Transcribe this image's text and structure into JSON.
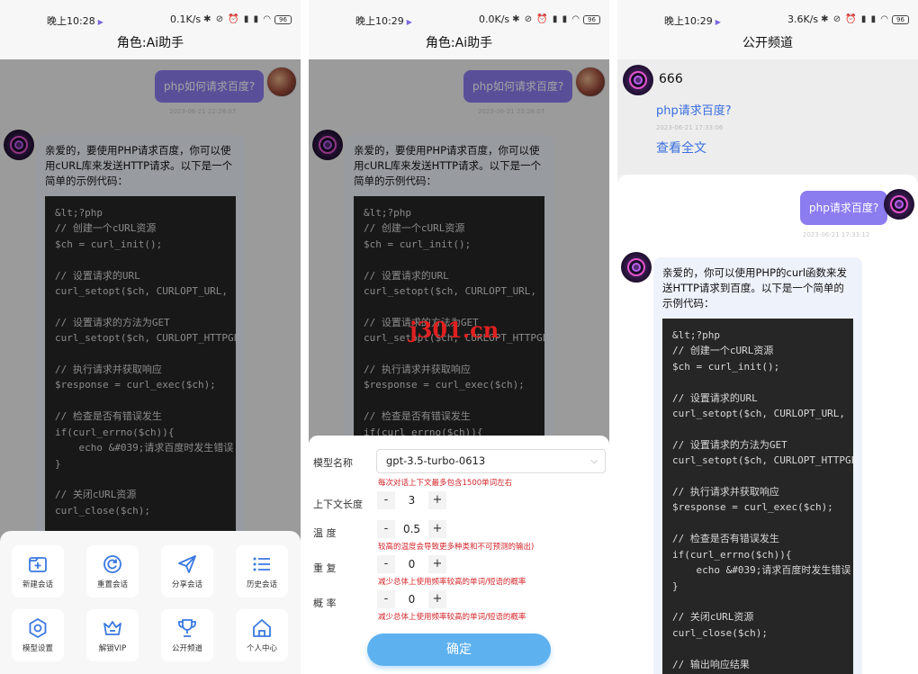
{
  "status": [
    {
      "time": "晚上10:28",
      "speed": "0.1K/s"
    },
    {
      "time": "晚上10:29",
      "speed": "0.0K/s"
    },
    {
      "time": "晚上10:29",
      "speed": "3.6K/s"
    }
  ],
  "status_icons": "✱ ⊘ ⏰ ▮ ▮ ◠",
  "battery": "96",
  "titles": [
    "角色:Ai助手",
    "角色:Ai助手",
    "公开频道"
  ],
  "chat1": {
    "user_msg": "php如何请求百度?",
    "timestamp": "2023-06-21 22:28:07",
    "ai_intro": "亲爱的，要使用PHP请求百度，你可以使用cURL库来发送HTTP请求。以下是一个简单的示例代码：",
    "code": "&lt;?php\n// 创建一个cURL资源\n$ch = curl_init();\n\n// 设置请求的URL\ncurl_setopt($ch, CURLOPT_URL, 'https://www.baidu.com');\n\n// 设置请求的方法为GET\ncurl_setopt($ch, CURLOPT_HTTPGET, true);\n\n// 执行请求并获取响应\n$response = curl_exec($ch);\n\n// 检查是否有错误发生\nif(curl_errno($ch)){\n    echo &#039;请求百度时发生错误\n}\n\n// 关闭cURL资源\ncurl_close($ch);"
  },
  "menu": [
    {
      "label": "新建会话",
      "icon": "new-chat-icon"
    },
    {
      "label": "重置会话",
      "icon": "reset-icon"
    },
    {
      "label": "分享会话",
      "icon": "share-icon"
    },
    {
      "label": "历史会话",
      "icon": "history-icon"
    },
    {
      "label": "模型设置",
      "icon": "settings-icon"
    },
    {
      "label": "解锁VIP",
      "icon": "vip-icon"
    },
    {
      "label": "公开频道",
      "icon": "trophy-icon"
    },
    {
      "label": "个人中心",
      "icon": "home-icon"
    }
  ],
  "settings": {
    "model_label": "模型名称",
    "model_value": "gpt-3.5-turbo-0613",
    "model_hint": "每次对话上下文最多包含1500单词左右",
    "context_label": "上下文长度",
    "context_value": "3",
    "temp_label": "温 度",
    "temp_value": "0.5",
    "temp_hint": "较高的温度会导致更多种类和不可预测的输出)",
    "repeat_label": "重 复",
    "repeat_value": "0",
    "repeat_hint": "减少总体上使用频率较高的单词/短语的概率",
    "prob_label": "概 率",
    "prob_value": "0",
    "prob_hint": "减少总体上使用频率较高的单词/短语的概率",
    "confirm": "确定",
    "minus": "-",
    "plus": "+"
  },
  "watermark": "j301.cn",
  "public": {
    "user_name": "666",
    "post_title": "php请求百度?",
    "post_time": "2023-06-21 17:33:06",
    "view_full": "查看全文",
    "user_msg": "php请求百度?",
    "timestamp": "2023-06-21 17:33:12",
    "ai_intro": "亲爱的，你可以使用PHP的curl函数来发送HTTP请求到百度。以下是一个简单的示例代码：",
    "code": "&lt;?php\n// 创建一个cURL资源\n$ch = curl_init();\n\n// 设置请求的URL\ncurl_setopt($ch, CURLOPT_URL, 'https://www.baidu.com');\n\n// 设置请求的方法为GET\ncurl_setopt($ch, CURLOPT_HTTPGET, true);\n\n// 执行请求并获取响应\n$response = curl_exec($ch);\n\n// 检查是否有错误发生\nif(curl_errno($ch)){\n    echo &#039;请求百度时发生错误\n}\n\n// 关闭cURL资源\ncurl_close($ch);\n\n// 输出响应结果"
  }
}
